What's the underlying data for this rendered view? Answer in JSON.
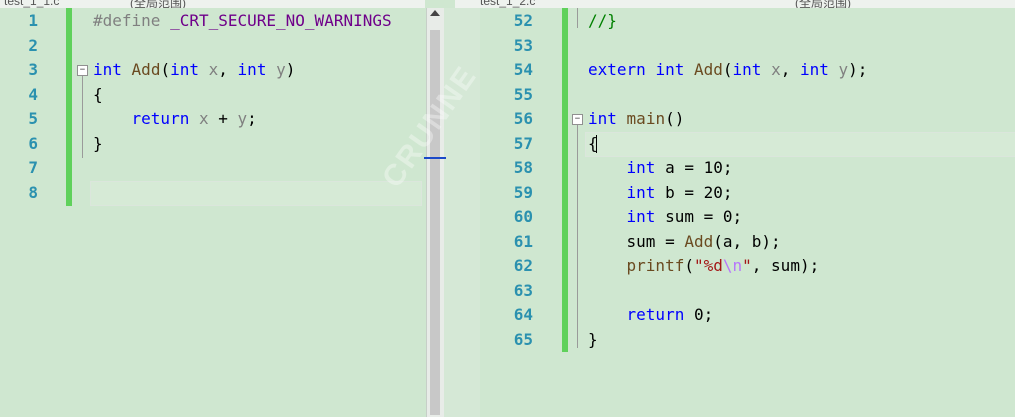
{
  "tabs": {
    "left_file": "test_1_1.c",
    "left_scope": "(全局范围)",
    "right_file": "test_1_2.c",
    "right_scope": "(全局范围)"
  },
  "watermark": "CRUNNE",
  "left_pane": {
    "lines": [
      {
        "n": "1",
        "tokens": [
          {
            "t": "#define ",
            "c": "pp"
          },
          {
            "t": "_CRT_SECURE_NO_WARNINGS",
            "c": "macro"
          }
        ]
      },
      {
        "n": "2",
        "tokens": []
      },
      {
        "n": "3",
        "tokens": [
          {
            "t": "int",
            "c": "kw"
          },
          {
            "t": " "
          },
          {
            "t": "Add",
            "c": "fn"
          },
          {
            "t": "("
          },
          {
            "t": "int",
            "c": "kw"
          },
          {
            "t": " "
          },
          {
            "t": "x",
            "c": "param"
          },
          {
            "t": ", "
          },
          {
            "t": "int",
            "c": "kw"
          },
          {
            "t": " "
          },
          {
            "t": "y",
            "c": "param"
          },
          {
            "t": ")"
          }
        ]
      },
      {
        "n": "4",
        "tokens": [
          {
            "t": "{"
          }
        ]
      },
      {
        "n": "5",
        "tokens": [
          {
            "t": "    "
          },
          {
            "t": "return",
            "c": "kw"
          },
          {
            "t": " "
          },
          {
            "t": "x",
            "c": "param"
          },
          {
            "t": " + "
          },
          {
            "t": "y",
            "c": "param"
          },
          {
            "t": ";"
          }
        ]
      },
      {
        "n": "6",
        "tokens": [
          {
            "t": "}"
          }
        ]
      },
      {
        "n": "7",
        "tokens": []
      },
      {
        "n": "8",
        "tokens": []
      }
    ]
  },
  "right_pane": {
    "lines": [
      {
        "n": "52",
        "tokens": [
          {
            "t": "//}",
            "c": "cmt"
          }
        ]
      },
      {
        "n": "53",
        "tokens": []
      },
      {
        "n": "54",
        "tokens": [
          {
            "t": "extern",
            "c": "kw"
          },
          {
            "t": " "
          },
          {
            "t": "int",
            "c": "kw"
          },
          {
            "t": " "
          },
          {
            "t": "Add",
            "c": "fn"
          },
          {
            "t": "("
          },
          {
            "t": "int",
            "c": "kw"
          },
          {
            "t": " "
          },
          {
            "t": "x",
            "c": "param"
          },
          {
            "t": ", "
          },
          {
            "t": "int",
            "c": "kw"
          },
          {
            "t": " "
          },
          {
            "t": "y",
            "c": "param"
          },
          {
            "t": ");"
          }
        ]
      },
      {
        "n": "55",
        "tokens": []
      },
      {
        "n": "56",
        "tokens": [
          {
            "t": "int",
            "c": "kw"
          },
          {
            "t": " "
          },
          {
            "t": "main",
            "c": "fn"
          },
          {
            "t": "()"
          }
        ]
      },
      {
        "n": "57",
        "tokens": [
          {
            "t": "{"
          }
        ]
      },
      {
        "n": "58",
        "tokens": [
          {
            "t": "    "
          },
          {
            "t": "int",
            "c": "kw"
          },
          {
            "t": " a = 10;"
          }
        ]
      },
      {
        "n": "59",
        "tokens": [
          {
            "t": "    "
          },
          {
            "t": "int",
            "c": "kw"
          },
          {
            "t": " b = 20;"
          }
        ]
      },
      {
        "n": "60",
        "tokens": [
          {
            "t": "    "
          },
          {
            "t": "int",
            "c": "kw"
          },
          {
            "t": " sum = 0;"
          }
        ]
      },
      {
        "n": "61",
        "tokens": [
          {
            "t": "    sum = "
          },
          {
            "t": "Add",
            "c": "fn"
          },
          {
            "t": "(a, b);"
          }
        ]
      },
      {
        "n": "62",
        "tokens": [
          {
            "t": "    "
          },
          {
            "t": "printf",
            "c": "fn"
          },
          {
            "t": "("
          },
          {
            "t": "\"%d",
            "c": "str"
          },
          {
            "t": "\\n",
            "c": "esc"
          },
          {
            "t": "\"",
            "c": "str"
          },
          {
            "t": ", sum);"
          }
        ]
      },
      {
        "n": "63",
        "tokens": []
      },
      {
        "n": "64",
        "tokens": [
          {
            "t": "    "
          },
          {
            "t": "return",
            "c": "kw"
          },
          {
            "t": " 0;"
          }
        ]
      },
      {
        "n": "65",
        "tokens": [
          {
            "t": "}"
          }
        ]
      }
    ]
  }
}
